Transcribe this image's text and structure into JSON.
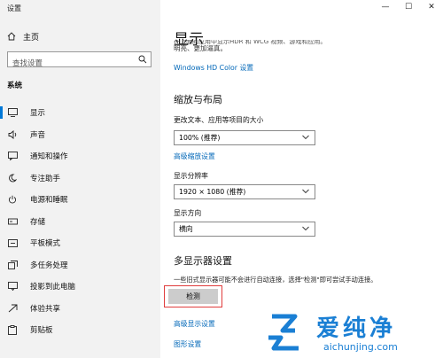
{
  "window": {
    "title": "设置",
    "controls": [
      "—",
      "☐",
      "✕"
    ]
  },
  "sidebar": {
    "home": "主页",
    "search_placeholder": "查找设置",
    "section": "系统",
    "items": [
      {
        "label": "显示",
        "icon": "display-icon",
        "active": true
      },
      {
        "label": "声音",
        "icon": "speaker-icon"
      },
      {
        "label": "通知和操作",
        "icon": "notification-icon"
      },
      {
        "label": "专注助手",
        "icon": "moon-icon"
      },
      {
        "label": "电源和睡眠",
        "icon": "power-icon"
      },
      {
        "label": "存储",
        "icon": "storage-icon"
      },
      {
        "label": "平板模式",
        "icon": "tablet-icon"
      },
      {
        "label": "多任务处理",
        "icon": "multitask-icon"
      },
      {
        "label": "投影到此电脑",
        "icon": "project-icon"
      },
      {
        "label": "体验共享",
        "icon": "share-icon"
      },
      {
        "label": "剪贴板",
        "icon": "clipboard-icon"
      }
    ]
  },
  "main": {
    "title": "显示",
    "hdr_partial": "在上面的应用中显示HDR 和 WCG 视频、游戏和应用。",
    "hdr_desc2": "明亮、更加逼真。",
    "hdr_link": "Windows HD Color 设置",
    "scale_heading": "缩放与布局",
    "scale_label": "更改文本、应用等项目的大小",
    "scale_value": "100% (推荐)",
    "scale_link": "高级缩放设置",
    "resolution_label": "显示分辨率",
    "resolution_value": "1920 × 1080 (推荐)",
    "orientation_label": "显示方向",
    "orientation_value": "横向",
    "multi_heading": "多显示器设置",
    "multi_note": "一些旧式显示器可能不会进行自动连接，选择\"检测\"即可尝试手动连接。",
    "detect_button": "检测",
    "advanced_link": "高级显示设置",
    "graphics_link": "图形设置"
  },
  "watermark": {
    "text": "爱纯净",
    "url": "aichunjing.com"
  },
  "colors": {
    "accent": "#0078d7",
    "link": "#0067b8",
    "highlight": "#e03c3c"
  }
}
